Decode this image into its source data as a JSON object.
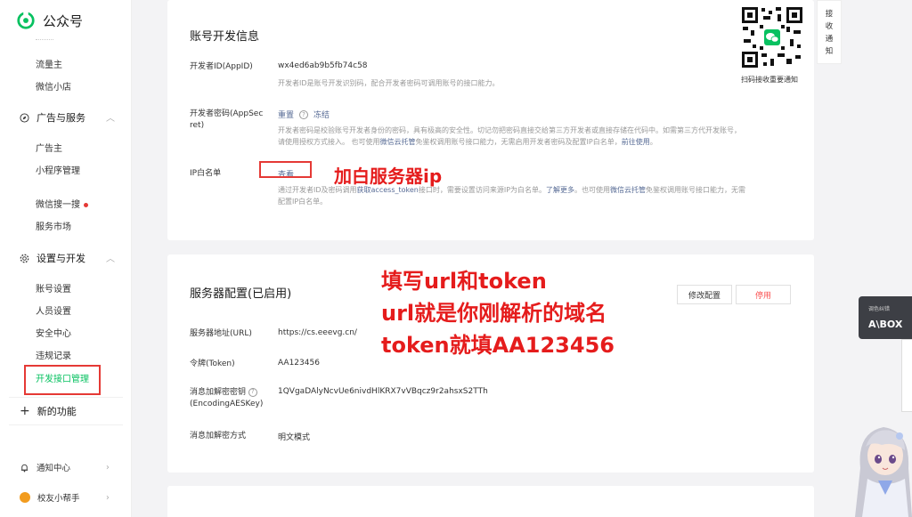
{
  "brand": {
    "name": "公众号"
  },
  "sidebar": {
    "items_top": [
      "流量主",
      "微信小店"
    ],
    "group_ads": "广告与服务",
    "ads_items": [
      "广告主",
      "小程序管理",
      "微信搜一搜",
      "服务市场"
    ],
    "group_dev": "设置与开发",
    "dev_items": [
      "账号设置",
      "人员设置",
      "安全中心",
      "违规记录",
      "开发接口管理"
    ],
    "new_func": "新的功能",
    "notify": "通知中心",
    "helper": "校友小帮手"
  },
  "dev_info": {
    "title": "账号开发信息",
    "appid_label": "开发者ID(AppID)",
    "appid_value": "wx4ed6ab9b5fb74c58",
    "appid_desc": "开发者ID是账号开发识别码，配合开发者密码可调用账号的接口能力。",
    "secret_label_1": "开发者密码(AppSec",
    "secret_label_2": "ret)",
    "reset": "重置",
    "freeze": "冻结",
    "secret_desc_1a": "开发者密码是校验账号开发者身份的密码，具有极高的安全性。切记勿把密码直接交给第三方开发者或直接存储在代码中。如需第三方代开发账号，",
    "secret_desc_2a": "请使用授权方式接入。 也可使用",
    "secret_desc_2b": "微信云托管",
    "secret_desc_2c": "免鉴权调用账号接口能力，无需启用开发者密码及配置IP白名单，",
    "secret_desc_2d": "前往使用",
    "secret_desc_2e": "。",
    "ip_label": "IP白名单",
    "ip_view": "查看",
    "ip_desc_1a": "通过开发者ID及密码调用",
    "ip_desc_1b": "获取access_token",
    "ip_desc_1c": "接口时，需要设置访问来源IP为白名单。",
    "ip_desc_1d": "了解更多",
    "ip_desc_1e": "。也可使用",
    "ip_desc_1f": "微信云托管",
    "ip_desc_1g": "免鉴权调用账号接口能力，无需",
    "ip_desc_2": "配置IP白名单。"
  },
  "server": {
    "title": "服务器配置(已启用)",
    "modify": "修改配置",
    "disable": "停用",
    "url_label": "服务器地址(URL)",
    "url_value": "https://cs.eeevg.cn/",
    "token_label": "令牌(Token)",
    "token_value": "AA123456",
    "aes_label_1": "消息加解密密钥",
    "aes_label_2": "(EncodingAESKey)",
    "aes_value": "1QVgaDAlyNcvUe6nivdHlKRX7vVBqcz9r2ahsxS2TTh",
    "mode_label": "消息加解密方式",
    "mode_value": "明文模式"
  },
  "annotations": {
    "ip": "加白服务器ip",
    "line1": "填写url和token",
    "line2": "url就是你刚解析的域名",
    "line3": "token就填AA123456"
  },
  "qr": {
    "caption": "扫码接收重要通知"
  },
  "notify_tab": [
    "接",
    "收",
    "通",
    "知"
  ],
  "abox": {
    "small": "调色纠错",
    "logo": "A\\BOX"
  },
  "colors": {
    "accent": "#07c160",
    "link": "#576b95",
    "annotation": "#e51c1c",
    "danger": "#fa5151"
  }
}
